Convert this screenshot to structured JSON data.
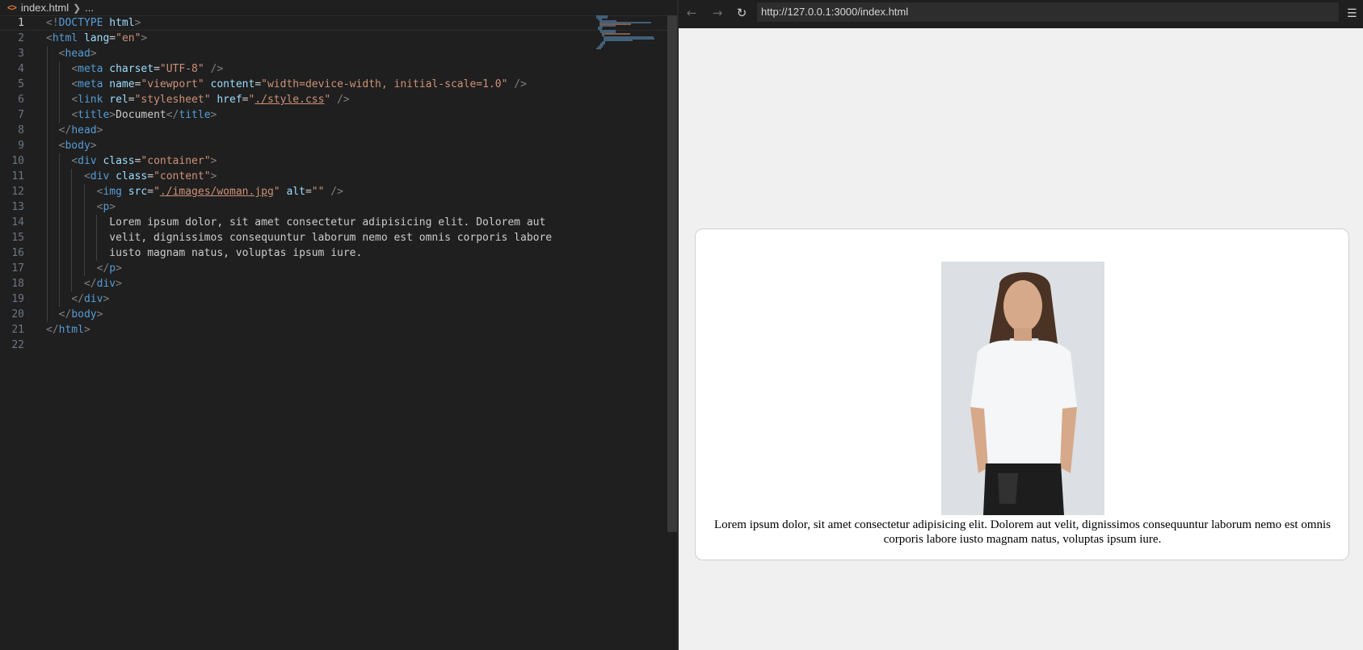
{
  "editor": {
    "breadcrumb": {
      "file": "index.html",
      "tail": "..."
    },
    "current_line": 1,
    "lines": [
      "<!DOCTYPE html>",
      "<html lang=\"en\">",
      "  <head>",
      "    <meta charset=\"UTF-8\" />",
      "    <meta name=\"viewport\" content=\"width=device-width, initial-scale=1.0\" />",
      "    <link rel=\"stylesheet\" href=\"./style.css\" />",
      "    <title>Document</title>",
      "  </head>",
      "  <body>",
      "    <div class=\"container\">",
      "      <div class=\"content\">",
      "        <img src=\"./images/woman.jpg\" alt=\"\" />",
      "        <p>",
      "          Lorem ipsum dolor, sit amet consectetur adipisicing elit. Dolorem aut",
      "          velit, dignissimos consequuntur laborum nemo est omnis corporis labore",
      "          iusto magnam natus, voluptas ipsum iure.",
      "        </p>",
      "      </div>",
      "    </div>",
      "  </body>",
      "</html>",
      ""
    ]
  },
  "browser": {
    "url": "http://127.0.0.1:3000/index.html",
    "paragraph": "Lorem ipsum dolor, sit amet consectetur adipisicing elit. Dolorem aut velit, dignissimos consequuntur laborum nemo est omnis corporis labore iusto magnam natus, voluptas ipsum iure.",
    "image_alt": "",
    "icons": {
      "back": "arrow-left-icon",
      "forward": "arrow-right-icon",
      "reload": "reload-icon",
      "menu": "hamburger-menu-icon"
    }
  },
  "colors": {
    "editor_bg": "#1f1f1f",
    "tag": "#569cd6",
    "attr": "#9cdcfe",
    "string": "#ce9178",
    "page_bg": "#f0f0f0"
  }
}
